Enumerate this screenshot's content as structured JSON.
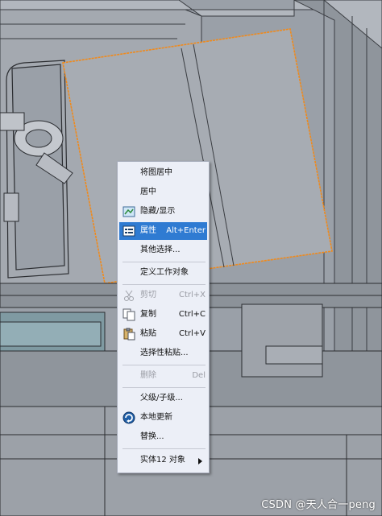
{
  "menu": {
    "items": [
      {
        "label": "将图居中",
        "icon": "",
        "shortcut": "",
        "enabled": true,
        "selected": false
      },
      {
        "label": "居中",
        "icon": "",
        "shortcut": "",
        "enabled": true,
        "selected": false
      },
      {
        "label": "隐藏/显示",
        "icon": "hide-show-icon",
        "shortcut": "",
        "enabled": true,
        "selected": false
      },
      {
        "label": "属性",
        "icon": "properties-icon",
        "shortcut": "Alt+Enter",
        "enabled": true,
        "selected": true
      },
      {
        "label": "其他选择...",
        "icon": "",
        "shortcut": "",
        "enabled": true,
        "selected": false
      },
      {
        "label": "定义工作对象",
        "icon": "",
        "shortcut": "",
        "enabled": true,
        "selected": false
      },
      {
        "label": "剪切",
        "icon": "scissors-icon",
        "shortcut": "Ctrl+X",
        "enabled": false,
        "selected": false
      },
      {
        "label": "复制",
        "icon": "copy-icon",
        "shortcut": "Ctrl+C",
        "enabled": true,
        "selected": false
      },
      {
        "label": "粘贴",
        "icon": "paste-icon",
        "shortcut": "Ctrl+V",
        "enabled": true,
        "selected": false
      },
      {
        "label": "选择性粘贴...",
        "icon": "",
        "shortcut": "",
        "enabled": true,
        "selected": false
      },
      {
        "label": "删除",
        "icon": "",
        "shortcut": "Del",
        "enabled": false,
        "selected": false
      },
      {
        "label": "父级/子级...",
        "icon": "",
        "shortcut": "",
        "enabled": true,
        "selected": false
      },
      {
        "label": "本地更新",
        "icon": "local-update-icon",
        "shortcut": "",
        "enabled": true,
        "selected": false
      },
      {
        "label": "替换...",
        "icon": "",
        "shortcut": "",
        "enabled": true,
        "selected": false
      },
      {
        "label": "实体12 对象",
        "icon": "",
        "shortcut": "",
        "enabled": true,
        "selected": false,
        "submenu": true
      }
    ]
  },
  "watermark": "CSDN @天人合一peng",
  "colors": {
    "selection_highlight": "#2f7bd2",
    "preselection_edge": "#f08a1c",
    "model_gray": "#9aa0a8"
  }
}
